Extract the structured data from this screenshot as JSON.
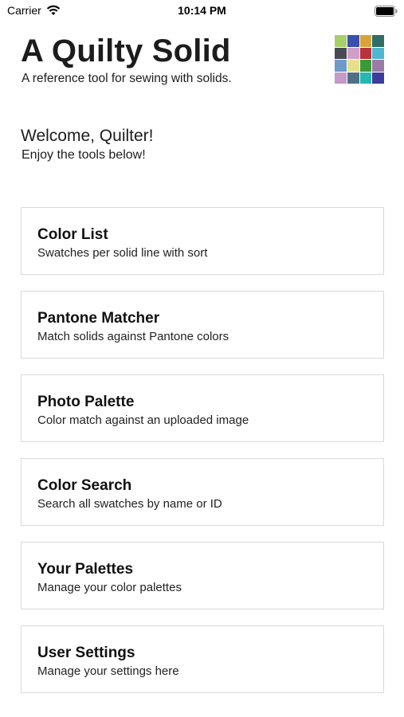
{
  "status_bar": {
    "carrier": "Carrier",
    "time": "10:14 PM",
    "wifi_icon": "wifi-icon",
    "battery_icon": "battery-icon"
  },
  "header": {
    "title": "A Quilty Solid",
    "subtitle": "A reference tool for sewing with solids.",
    "logo_colors": [
      "#a9cf6b",
      "#3b4fb0",
      "#d8a43a",
      "#2f6e64",
      "#4a4a52",
      "#cf9ec9",
      "#b8333b",
      "#4fb7cf",
      "#6f99c9",
      "#e7e08a",
      "#3a9a3a",
      "#9b7aa8",
      "#c49ac6",
      "#4f6f86",
      "#27b7b2",
      "#3d3c9c"
    ]
  },
  "welcome": {
    "title": "Welcome, Quilter!",
    "subtitle": "Enjoy the tools below!"
  },
  "menu": [
    {
      "title": "Color List",
      "description": "Swatches per solid line with sort"
    },
    {
      "title": "Pantone Matcher",
      "description": "Match solids against Pantone colors"
    },
    {
      "title": "Photo Palette",
      "description": "Color match against an uploaded image"
    },
    {
      "title": "Color Search",
      "description": "Search all swatches by name or ID"
    },
    {
      "title": "Your Palettes",
      "description": "Manage your color palettes"
    },
    {
      "title": "User Settings",
      "description": "Manage your settings here"
    }
  ]
}
